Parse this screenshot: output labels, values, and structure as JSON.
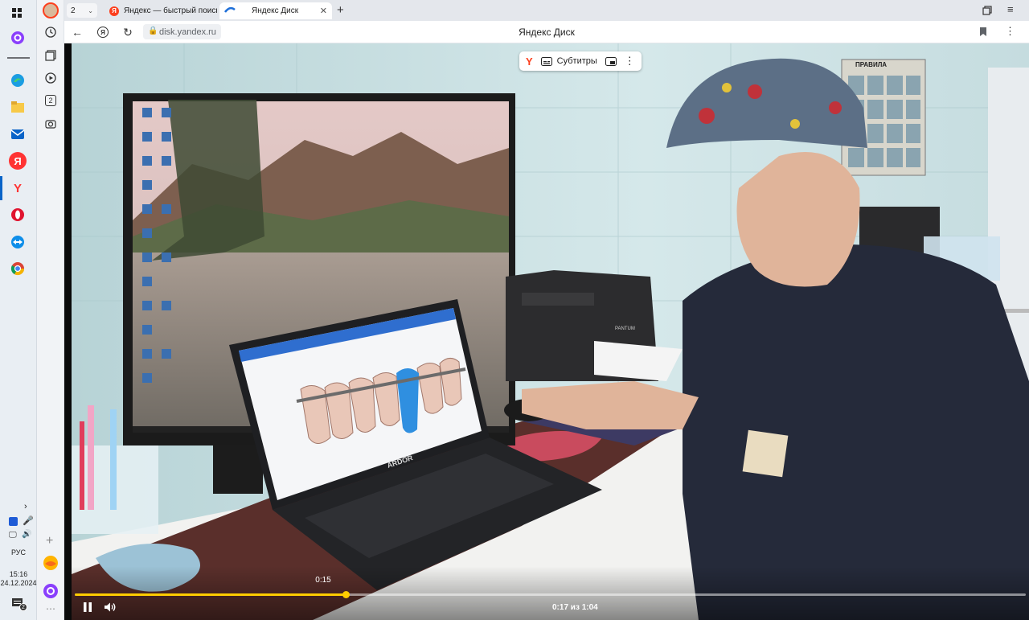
{
  "taskbar": {
    "time": "15:16",
    "date": "24.12.2024",
    "language": "РУС",
    "notification_count": "2"
  },
  "browser": {
    "tab_count": "2",
    "tabs": [
      {
        "label": "Яндекс — быстрый поиск"
      },
      {
        "label": "Яндекс Диск"
      }
    ],
    "url": "disk.yandex.ru",
    "page_title": "Яндекс Диск",
    "sidebar_badge": "2"
  },
  "player": {
    "subtitles_label": "Субтитры",
    "hover_time": "0:15",
    "time_display": "0:17 из 1:04",
    "progress": 0.285,
    "accent": "#ffcc00"
  },
  "scene": {
    "laptop_brand": "ARDOR",
    "printer_brand": "PANTUM",
    "poster_title": "ПРАВИЛА"
  }
}
